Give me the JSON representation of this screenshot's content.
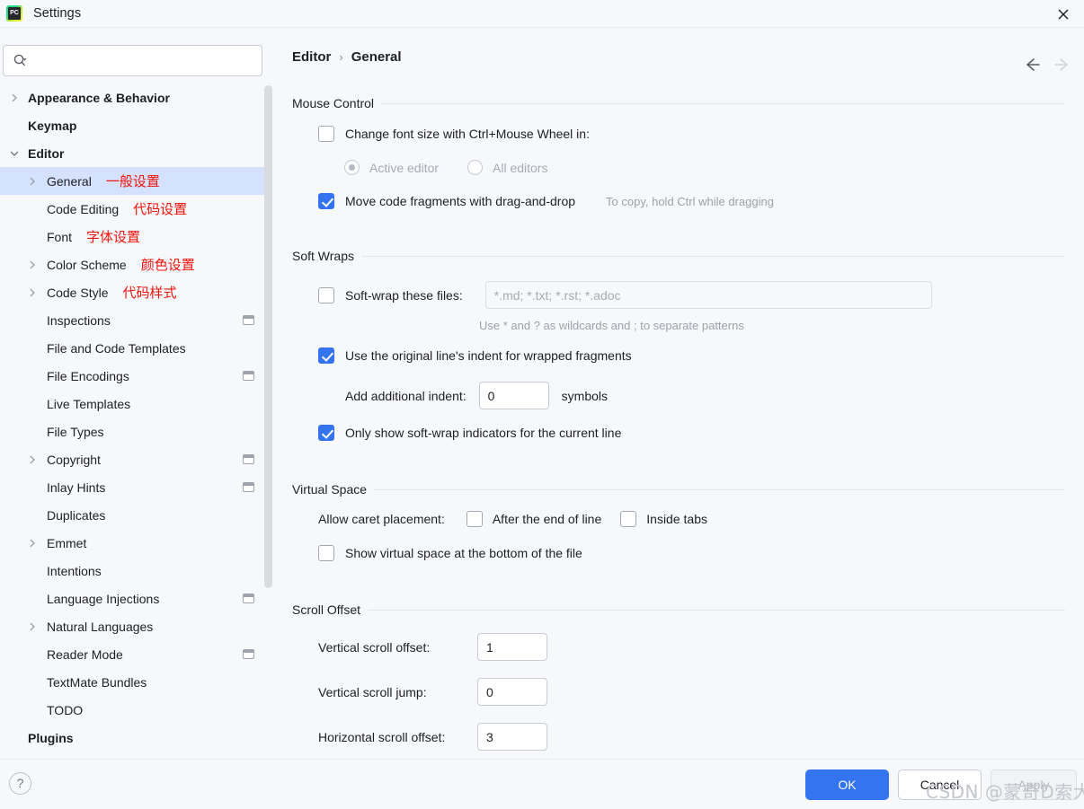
{
  "window": {
    "title": "Settings",
    "app_icon": "pycharm-logo",
    "close_icon": "close-icon"
  },
  "search": {
    "value": "",
    "placeholder": "",
    "icon": "search-icon"
  },
  "sidebar": {
    "items": [
      {
        "label": "Appearance & Behavior",
        "cn": "",
        "indent": 0,
        "bold": true,
        "arrow": "right",
        "badge": false,
        "selected": false
      },
      {
        "label": "Keymap",
        "cn": "",
        "indent": 0,
        "bold": true,
        "arrow": "",
        "badge": false,
        "selected": false
      },
      {
        "label": "Editor",
        "cn": "",
        "indent": 0,
        "bold": true,
        "arrow": "down",
        "badge": false,
        "selected": false
      },
      {
        "label": "General",
        "cn": "一般设置",
        "indent": 1,
        "bold": false,
        "arrow": "right",
        "badge": false,
        "selected": true
      },
      {
        "label": "Code Editing",
        "cn": "代码设置",
        "indent": 1,
        "bold": false,
        "arrow": "",
        "badge": false,
        "selected": false
      },
      {
        "label": "Font",
        "cn": "字体设置",
        "indent": 1,
        "bold": false,
        "arrow": "",
        "badge": false,
        "selected": false
      },
      {
        "label": "Color Scheme",
        "cn": "颜色设置",
        "indent": 1,
        "bold": false,
        "arrow": "right",
        "badge": false,
        "selected": false
      },
      {
        "label": "Code Style",
        "cn": "代码样式",
        "indent": 1,
        "bold": false,
        "arrow": "right",
        "badge": false,
        "selected": false
      },
      {
        "label": "Inspections",
        "cn": "",
        "indent": 1,
        "bold": false,
        "arrow": "",
        "badge": true,
        "selected": false
      },
      {
        "label": "File and Code Templates",
        "cn": "",
        "indent": 1,
        "bold": false,
        "arrow": "",
        "badge": false,
        "selected": false
      },
      {
        "label": "File Encodings",
        "cn": "",
        "indent": 1,
        "bold": false,
        "arrow": "",
        "badge": true,
        "selected": false
      },
      {
        "label": "Live Templates",
        "cn": "",
        "indent": 1,
        "bold": false,
        "arrow": "",
        "badge": false,
        "selected": false
      },
      {
        "label": "File Types",
        "cn": "",
        "indent": 1,
        "bold": false,
        "arrow": "",
        "badge": false,
        "selected": false
      },
      {
        "label": "Copyright",
        "cn": "",
        "indent": 1,
        "bold": false,
        "arrow": "right",
        "badge": true,
        "selected": false
      },
      {
        "label": "Inlay Hints",
        "cn": "",
        "indent": 1,
        "bold": false,
        "arrow": "",
        "badge": true,
        "selected": false
      },
      {
        "label": "Duplicates",
        "cn": "",
        "indent": 1,
        "bold": false,
        "arrow": "",
        "badge": false,
        "selected": false
      },
      {
        "label": "Emmet",
        "cn": "",
        "indent": 1,
        "bold": false,
        "arrow": "right",
        "badge": false,
        "selected": false
      },
      {
        "label": "Intentions",
        "cn": "",
        "indent": 1,
        "bold": false,
        "arrow": "",
        "badge": false,
        "selected": false
      },
      {
        "label": "Language Injections",
        "cn": "",
        "indent": 1,
        "bold": false,
        "arrow": "",
        "badge": true,
        "selected": false
      },
      {
        "label": "Natural Languages",
        "cn": "",
        "indent": 1,
        "bold": false,
        "arrow": "right",
        "badge": false,
        "selected": false
      },
      {
        "label": "Reader Mode",
        "cn": "",
        "indent": 1,
        "bold": false,
        "arrow": "",
        "badge": true,
        "selected": false
      },
      {
        "label": "TextMate Bundles",
        "cn": "",
        "indent": 1,
        "bold": false,
        "arrow": "",
        "badge": false,
        "selected": false
      },
      {
        "label": "TODO",
        "cn": "",
        "indent": 1,
        "bold": false,
        "arrow": "",
        "badge": false,
        "selected": false
      },
      {
        "label": "Plugins",
        "cn": "",
        "indent": 0,
        "bold": true,
        "arrow": "",
        "badge": false,
        "selected": false
      }
    ]
  },
  "main": {
    "breadcrumb": {
      "parent": "Editor",
      "separator": "›",
      "current": "General"
    },
    "nav": {
      "back_icon": "arrow-left-icon",
      "forward_icon": "arrow-right-icon"
    },
    "sections": {
      "mouse_control": {
        "title": "Mouse Control",
        "change_font_size": {
          "label": "Change font size with Ctrl+Mouse Wheel in:",
          "checked": false
        },
        "radios": [
          {
            "label": "Active editor",
            "selected": true
          },
          {
            "label": "All editors",
            "selected": false
          }
        ],
        "drag_and_drop": {
          "label": "Move code fragments with drag-and-drop",
          "checked": true
        },
        "drag_hint": "To copy, hold Ctrl while dragging"
      },
      "soft_wraps": {
        "title": "Soft Wraps",
        "soft_wrap_files": {
          "label": "Soft-wrap these files:",
          "checked": false,
          "value": "",
          "placeholder": "*.md; *.txt; *.rst; *.adoc"
        },
        "wildcards_hint": "Use * and ? as wildcards and ; to separate patterns",
        "original_indent": {
          "label": "Use the original line's indent for wrapped fragments",
          "checked": true
        },
        "additional_indent": {
          "label": "Add additional indent:",
          "value": "0",
          "suffix": "symbols"
        },
        "only_current_line": {
          "label": "Only show soft-wrap indicators for the current line",
          "checked": true
        }
      },
      "virtual_space": {
        "title": "Virtual Space",
        "allow_caret_label": "Allow caret placement:",
        "after_end_of_line": {
          "label": "After the end of line",
          "checked": false
        },
        "inside_tabs": {
          "label": "Inside tabs",
          "checked": false
        },
        "show_virtual_space": {
          "label": "Show virtual space at the bottom of the file",
          "checked": false
        }
      },
      "scroll_offset": {
        "title": "Scroll Offset",
        "fields": [
          {
            "label": "Vertical scroll offset:",
            "value": "1"
          },
          {
            "label": "Vertical scroll jump:",
            "value": "0"
          },
          {
            "label": "Horizontal scroll offset:",
            "value": "3"
          }
        ]
      }
    }
  },
  "footer": {
    "help_icon": "question-mark-icon",
    "ok_label": "OK",
    "cancel_label": "Cancel",
    "apply_label": "Apply"
  },
  "watermark": {
    "text": "CSDN @蒙奇D索大"
  },
  "colors": {
    "accent": "#3574F0",
    "selection": "#D4E2FF",
    "annotation_red": "#F3130B",
    "background": "#F7F8FA"
  }
}
